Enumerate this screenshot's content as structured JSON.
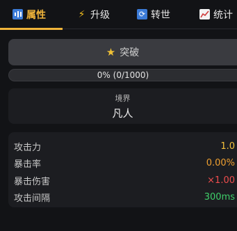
{
  "tabs": [
    {
      "label": "属性",
      "icon": "bar-chart-icon",
      "active": true
    },
    {
      "label": "升级",
      "icon": "lightning-icon",
      "active": false
    },
    {
      "label": "转世",
      "icon": "cycle-icon",
      "active": false
    },
    {
      "label": "统计",
      "icon": "trend-chart-icon",
      "active": false
    }
  ],
  "breakthrough": {
    "label": "突破",
    "icon": "star-icon"
  },
  "progress": {
    "text": "0% (0/1000)",
    "current": 0,
    "max": 1000,
    "fraction": 0.0
  },
  "realm": {
    "label": "境界",
    "value": "凡人"
  },
  "stats": [
    {
      "name": "攻击力",
      "value": "1.0",
      "color": "#f5c13b"
    },
    {
      "name": "暴击率",
      "value": "0.00%",
      "color": "#f0a030"
    },
    {
      "name": "暴击伤害",
      "value": "×1.00",
      "color": "#ef4d4d"
    },
    {
      "name": "攻击间隔",
      "value": "300ms",
      "color": "#3fd06a"
    }
  ],
  "colors": {
    "accent": "#f0b43a",
    "background": "#121316",
    "panel": "#1c1d21"
  }
}
